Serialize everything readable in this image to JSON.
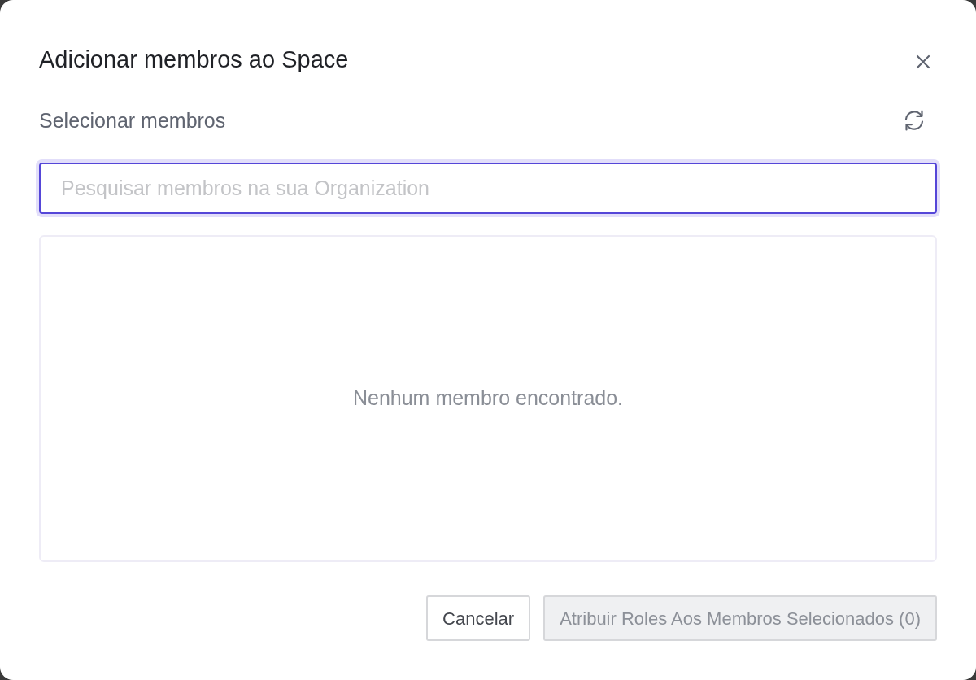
{
  "dialog": {
    "title": "Adicionar membros ao Space"
  },
  "section": {
    "label": "Selecionar membros"
  },
  "search": {
    "placeholder": "Pesquisar membros na sua Organization",
    "focused": true
  },
  "results": {
    "empty_message": "Nenhum membro encontrado."
  },
  "buttons": [
    {
      "label": "Cancelar",
      "kind": "secondary",
      "disabled": false
    },
    {
      "label": "Atribuir Roles Aos Membros Selecionados (0)",
      "kind": "primary",
      "disabled": true
    }
  ]
}
